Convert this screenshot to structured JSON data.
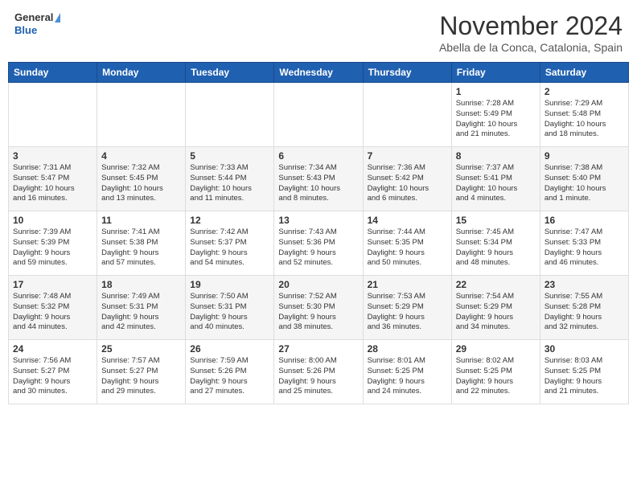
{
  "header": {
    "logo_line1": "General",
    "logo_line2": "Blue",
    "month": "November 2024",
    "location": "Abella de la Conca, Catalonia, Spain"
  },
  "weekdays": [
    "Sunday",
    "Monday",
    "Tuesday",
    "Wednesday",
    "Thursday",
    "Friday",
    "Saturday"
  ],
  "weeks": [
    [
      {
        "day": "",
        "content": ""
      },
      {
        "day": "",
        "content": ""
      },
      {
        "day": "",
        "content": ""
      },
      {
        "day": "",
        "content": ""
      },
      {
        "day": "",
        "content": ""
      },
      {
        "day": "1",
        "content": "Sunrise: 7:28 AM\nSunset: 5:49 PM\nDaylight: 10 hours\nand 21 minutes."
      },
      {
        "day": "2",
        "content": "Sunrise: 7:29 AM\nSunset: 5:48 PM\nDaylight: 10 hours\nand 18 minutes."
      }
    ],
    [
      {
        "day": "3",
        "content": "Sunrise: 7:31 AM\nSunset: 5:47 PM\nDaylight: 10 hours\nand 16 minutes."
      },
      {
        "day": "4",
        "content": "Sunrise: 7:32 AM\nSunset: 5:45 PM\nDaylight: 10 hours\nand 13 minutes."
      },
      {
        "day": "5",
        "content": "Sunrise: 7:33 AM\nSunset: 5:44 PM\nDaylight: 10 hours\nand 11 minutes."
      },
      {
        "day": "6",
        "content": "Sunrise: 7:34 AM\nSunset: 5:43 PM\nDaylight: 10 hours\nand 8 minutes."
      },
      {
        "day": "7",
        "content": "Sunrise: 7:36 AM\nSunset: 5:42 PM\nDaylight: 10 hours\nand 6 minutes."
      },
      {
        "day": "8",
        "content": "Sunrise: 7:37 AM\nSunset: 5:41 PM\nDaylight: 10 hours\nand 4 minutes."
      },
      {
        "day": "9",
        "content": "Sunrise: 7:38 AM\nSunset: 5:40 PM\nDaylight: 10 hours\nand 1 minute."
      }
    ],
    [
      {
        "day": "10",
        "content": "Sunrise: 7:39 AM\nSunset: 5:39 PM\nDaylight: 9 hours\nand 59 minutes."
      },
      {
        "day": "11",
        "content": "Sunrise: 7:41 AM\nSunset: 5:38 PM\nDaylight: 9 hours\nand 57 minutes."
      },
      {
        "day": "12",
        "content": "Sunrise: 7:42 AM\nSunset: 5:37 PM\nDaylight: 9 hours\nand 54 minutes."
      },
      {
        "day": "13",
        "content": "Sunrise: 7:43 AM\nSunset: 5:36 PM\nDaylight: 9 hours\nand 52 minutes."
      },
      {
        "day": "14",
        "content": "Sunrise: 7:44 AM\nSunset: 5:35 PM\nDaylight: 9 hours\nand 50 minutes."
      },
      {
        "day": "15",
        "content": "Sunrise: 7:45 AM\nSunset: 5:34 PM\nDaylight: 9 hours\nand 48 minutes."
      },
      {
        "day": "16",
        "content": "Sunrise: 7:47 AM\nSunset: 5:33 PM\nDaylight: 9 hours\nand 46 minutes."
      }
    ],
    [
      {
        "day": "17",
        "content": "Sunrise: 7:48 AM\nSunset: 5:32 PM\nDaylight: 9 hours\nand 44 minutes."
      },
      {
        "day": "18",
        "content": "Sunrise: 7:49 AM\nSunset: 5:31 PM\nDaylight: 9 hours\nand 42 minutes."
      },
      {
        "day": "19",
        "content": "Sunrise: 7:50 AM\nSunset: 5:31 PM\nDaylight: 9 hours\nand 40 minutes."
      },
      {
        "day": "20",
        "content": "Sunrise: 7:52 AM\nSunset: 5:30 PM\nDaylight: 9 hours\nand 38 minutes."
      },
      {
        "day": "21",
        "content": "Sunrise: 7:53 AM\nSunset: 5:29 PM\nDaylight: 9 hours\nand 36 minutes."
      },
      {
        "day": "22",
        "content": "Sunrise: 7:54 AM\nSunset: 5:29 PM\nDaylight: 9 hours\nand 34 minutes."
      },
      {
        "day": "23",
        "content": "Sunrise: 7:55 AM\nSunset: 5:28 PM\nDaylight: 9 hours\nand 32 minutes."
      }
    ],
    [
      {
        "day": "24",
        "content": "Sunrise: 7:56 AM\nSunset: 5:27 PM\nDaylight: 9 hours\nand 30 minutes."
      },
      {
        "day": "25",
        "content": "Sunrise: 7:57 AM\nSunset: 5:27 PM\nDaylight: 9 hours\nand 29 minutes."
      },
      {
        "day": "26",
        "content": "Sunrise: 7:59 AM\nSunset: 5:26 PM\nDaylight: 9 hours\nand 27 minutes."
      },
      {
        "day": "27",
        "content": "Sunrise: 8:00 AM\nSunset: 5:26 PM\nDaylight: 9 hours\nand 25 minutes."
      },
      {
        "day": "28",
        "content": "Sunrise: 8:01 AM\nSunset: 5:25 PM\nDaylight: 9 hours\nand 24 minutes."
      },
      {
        "day": "29",
        "content": "Sunrise: 8:02 AM\nSunset: 5:25 PM\nDaylight: 9 hours\nand 22 minutes."
      },
      {
        "day": "30",
        "content": "Sunrise: 8:03 AM\nSunset: 5:25 PM\nDaylight: 9 hours\nand 21 minutes."
      }
    ]
  ]
}
